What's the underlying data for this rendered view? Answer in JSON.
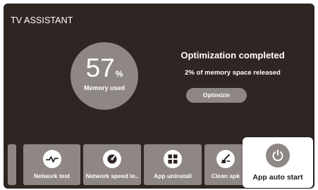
{
  "app": {
    "title": "TV ASSISTANT"
  },
  "memory": {
    "value": "57",
    "unit": "%",
    "label": "Memory used"
  },
  "status": {
    "title": "Optimization completed",
    "subtitle": "2% of memory space released",
    "button_label": "Optimizie"
  },
  "tools": [
    {
      "label": "Network test",
      "icon": "pulse-icon"
    },
    {
      "label": "Network speed te..",
      "icon": "speedometer-icon"
    },
    {
      "label": "App uninstall",
      "icon": "grid-icon"
    },
    {
      "label": "Clean apk",
      "icon": "broom-icon"
    },
    {
      "label": "App auto start",
      "icon": "power-icon",
      "selected": true
    }
  ],
  "colors": {
    "background": "#2f2522",
    "tile": "#8e8784",
    "text": "#ffffff",
    "selected_tile": "#ffffff"
  }
}
